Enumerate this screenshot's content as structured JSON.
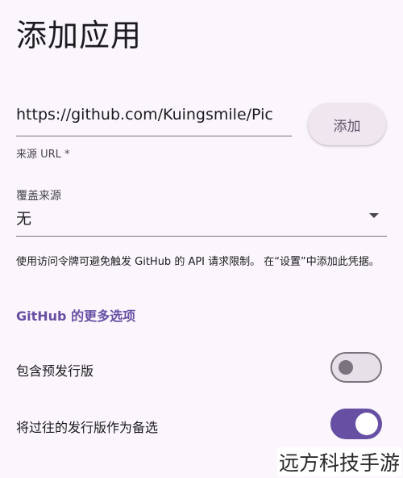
{
  "header": {
    "title": "添加应用"
  },
  "source_url": {
    "value": "https://github.com/Kuingsmile/Pic",
    "label": "来源 URL *"
  },
  "actions": {
    "add_label": "添加"
  },
  "override_source": {
    "label": "覆盖来源",
    "selected": "无",
    "icon": "arrow-drop-down-icon"
  },
  "helper": {
    "text": "使用访问令牌可避免触发 GitHub 的 API 请求限制。 在“设置”中添加此凭据。"
  },
  "github_options": {
    "heading": "GitHub 的更多选项",
    "settings": [
      {
        "label": "包含预发行版",
        "enabled": false
      },
      {
        "label": "将过往的发行版作为备选",
        "enabled": true
      }
    ]
  },
  "watermark": {
    "text": "远方科技手游"
  },
  "colors": {
    "background": "#fbf6fb",
    "accent": "#6750a4",
    "button_bg": "#efe6f0"
  }
}
